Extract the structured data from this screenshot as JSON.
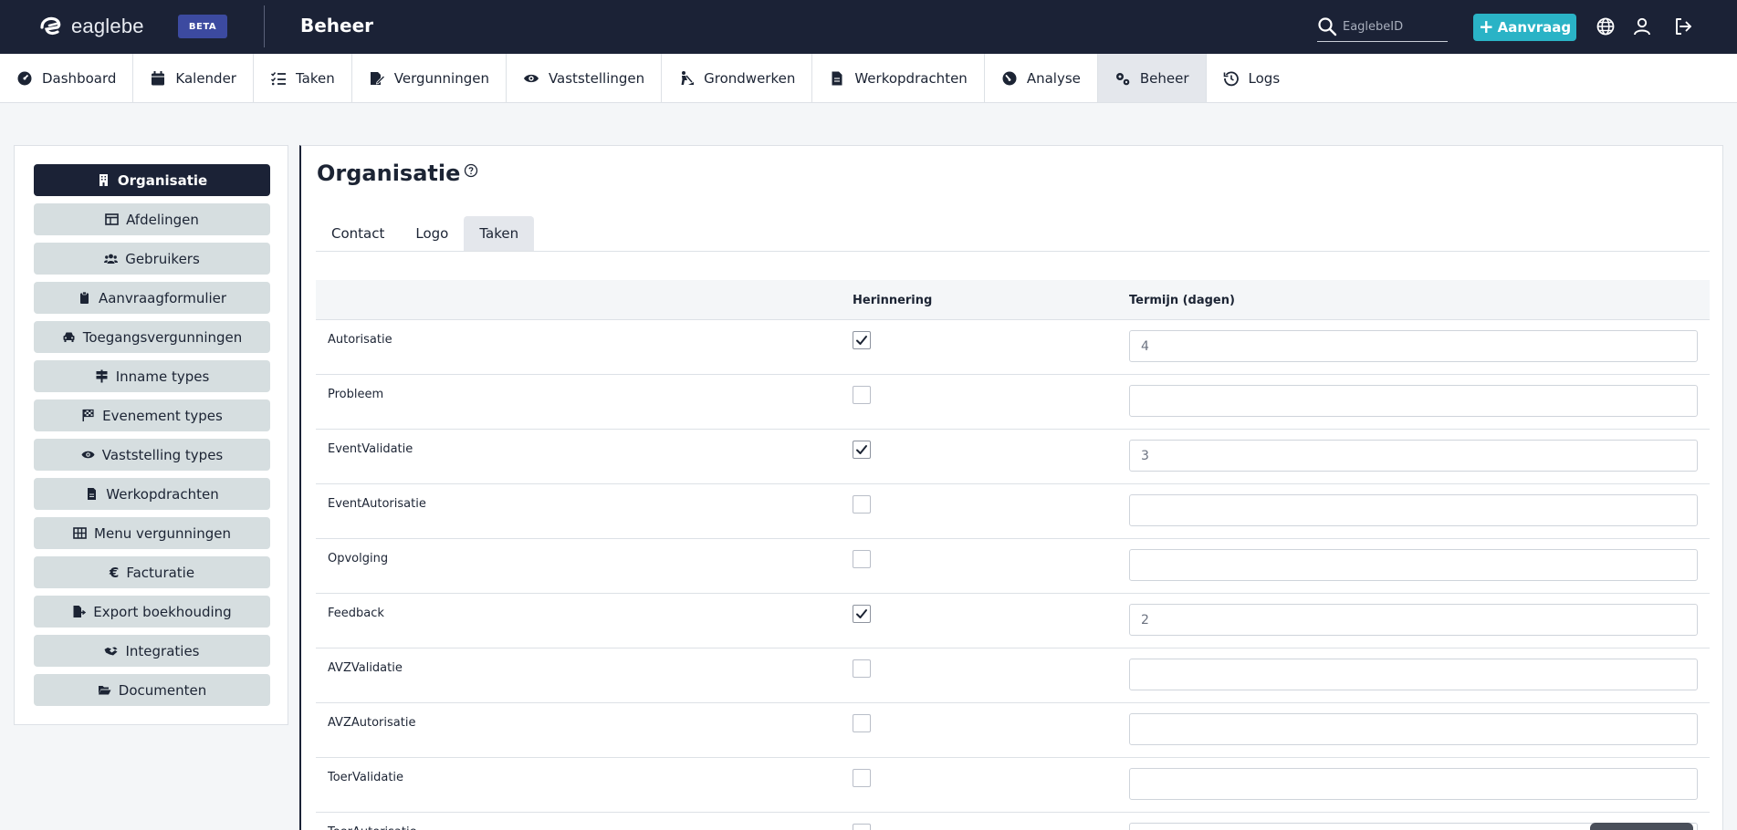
{
  "app": {
    "logo_text": "eaglebe",
    "beta_label": "BETA",
    "section_title": "Beheer"
  },
  "topbar": {
    "search_placeholder": "EaglebeID",
    "aanvraag_label": "Aanvraag",
    "icons": [
      "search-icon",
      "globe-icon",
      "user-icon",
      "logout-icon"
    ]
  },
  "modules": [
    {
      "label": "Dashboard",
      "icon": "dashboard-icon",
      "active": false
    },
    {
      "label": "Kalender",
      "icon": "calendar-icon",
      "active": false
    },
    {
      "label": "Taken",
      "icon": "tasks-icon",
      "active": false
    },
    {
      "label": "Vergunningen",
      "icon": "permit-icon",
      "active": false
    },
    {
      "label": "Vaststellingen",
      "icon": "eye-icon",
      "active": false
    },
    {
      "label": "Grondwerken",
      "icon": "digging-icon",
      "active": false
    },
    {
      "label": "Werkopdrachten",
      "icon": "file-icon",
      "active": false
    },
    {
      "label": "Analyse",
      "icon": "gauge-icon",
      "active": false
    },
    {
      "label": "Beheer",
      "icon": "gears-icon",
      "active": true
    },
    {
      "label": "Logs",
      "icon": "history-icon",
      "active": false
    }
  ],
  "sidebar": {
    "items": [
      {
        "label": "Organisatie",
        "icon": "building-icon",
        "active": true
      },
      {
        "label": "Afdelingen",
        "icon": "table-icon",
        "active": false
      },
      {
        "label": "Gebruikers",
        "icon": "users-icon",
        "active": false
      },
      {
        "label": "Aanvraagformulier",
        "icon": "clipboard-icon",
        "active": false
      },
      {
        "label": "Toegangsvergunningen",
        "icon": "car-icon",
        "active": false
      },
      {
        "label": "Inname types",
        "icon": "signs-icon",
        "active": false
      },
      {
        "label": "Evenement types",
        "icon": "flag-icon",
        "active": false
      },
      {
        "label": "Vaststelling types",
        "icon": "eye-icon",
        "active": false
      },
      {
        "label": "Werkopdrachten",
        "icon": "file-icon",
        "active": false
      },
      {
        "label": "Menu vergunningen",
        "icon": "grid-icon",
        "active": false
      },
      {
        "label": "Facturatie",
        "icon": "euro-icon",
        "active": false
      },
      {
        "label": "Export boekhouding",
        "icon": "file-export-icon",
        "active": false
      },
      {
        "label": "Integraties",
        "icon": "handshake-icon",
        "active": false
      },
      {
        "label": "Documenten",
        "icon": "folder-open-icon",
        "active": false
      }
    ]
  },
  "main": {
    "title": "Organisatie",
    "tabs": [
      {
        "label": "Contact",
        "active": false
      },
      {
        "label": "Logo",
        "active": false
      },
      {
        "label": "Taken",
        "active": true
      }
    ],
    "table": {
      "columns": [
        "",
        "Herinnering",
        "Termijn (dagen)"
      ],
      "rows": [
        {
          "name": "Autorisatie",
          "herinnering": true,
          "termijn": "4"
        },
        {
          "name": "Probleem",
          "herinnering": false,
          "termijn": ""
        },
        {
          "name": "EventValidatie",
          "herinnering": true,
          "termijn": "3"
        },
        {
          "name": "EventAutorisatie",
          "herinnering": false,
          "termijn": ""
        },
        {
          "name": "Opvolging",
          "herinnering": false,
          "termijn": ""
        },
        {
          "name": "Feedback",
          "herinnering": true,
          "termijn": "2"
        },
        {
          "name": "AVZValidatie",
          "herinnering": false,
          "termijn": ""
        },
        {
          "name": "AVZAutorisatie",
          "herinnering": false,
          "termijn": ""
        },
        {
          "name": "ToerValidatie",
          "herinnering": false,
          "termijn": ""
        },
        {
          "name": "ToerAutorisatie",
          "herinnering": false,
          "termijn": ""
        }
      ]
    }
  },
  "colors": {
    "topbar_bg": "#1b2236",
    "accent": "#2ab3c6",
    "beta_bg": "#3c4aa0",
    "sidebar_item_bg": "#d6dee0",
    "active_nav_bg": "#e4e7ec"
  }
}
